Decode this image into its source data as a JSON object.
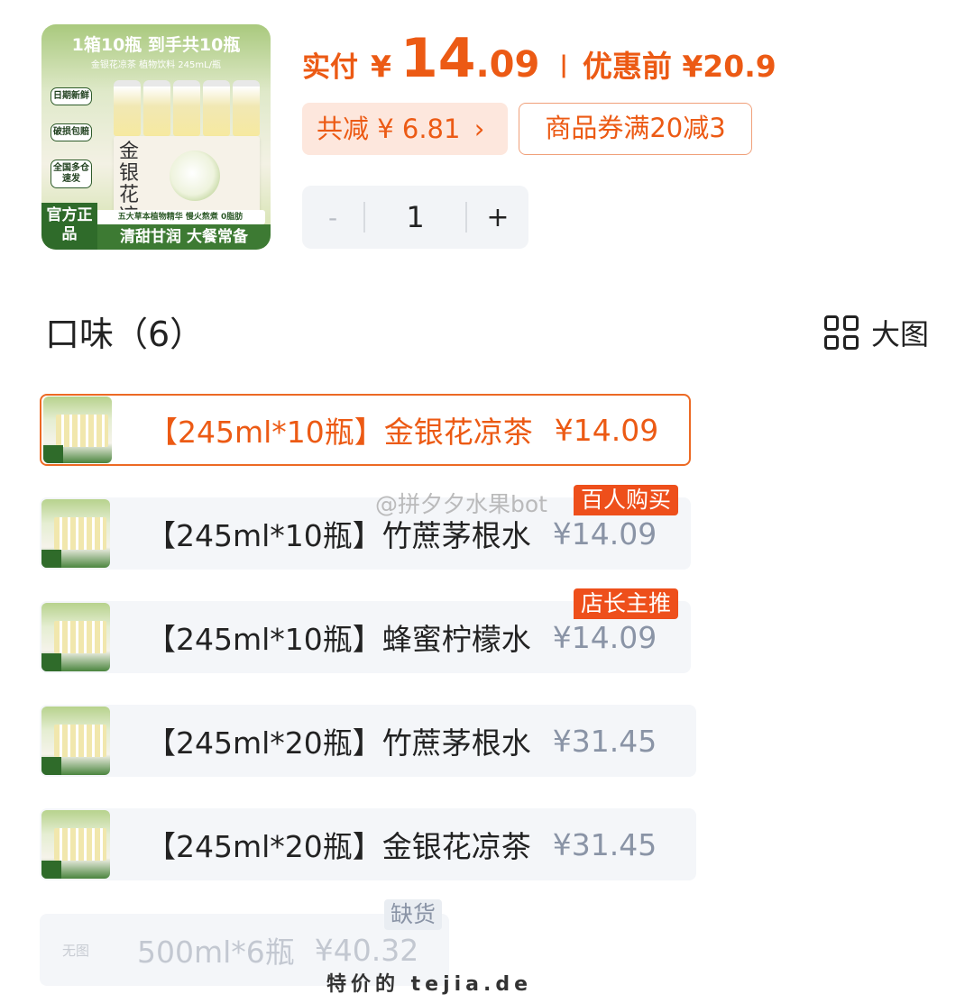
{
  "product": {
    "image": {
      "headline": "1箱10瓶 到手共10瓶",
      "subline": "金银花凉茶 植物饮料 245mL/瓶",
      "badges": [
        "日期新鲜",
        "破损包赔",
        "全国多仓速发"
      ],
      "box_text": "金银花凉茶",
      "strip": "五大草本植物精华 慢火熬煮 0脂肪",
      "official": "官方正品",
      "slogan": "清甜甘润 大餐常备"
    },
    "price_label": "实付",
    "currency": "¥",
    "price_int": "14",
    "price_dec": ".09",
    "separator": "|",
    "orig_label": "优惠前 ¥20.9",
    "discount_text": "共减 ¥ 6.81",
    "discount_chevron": "›",
    "coupon_text": "商品券满20减3",
    "stepper": {
      "minus": "-",
      "qty": "1",
      "plus": "+"
    }
  },
  "section": {
    "title": "口味（6）",
    "big_view_label": "大图"
  },
  "options": [
    {
      "label": "【245ml*10瓶】金银花凉茶",
      "price": "¥14.09",
      "selected": true
    },
    {
      "label": "【245ml*10瓶】竹蔗茅根水",
      "price": "¥14.09",
      "tag": "百人购买"
    },
    {
      "label": "【245ml*10瓶】蜂蜜柠檬水",
      "price": "¥14.09",
      "tag": "店长主推"
    },
    {
      "label": "【245ml*20瓶】竹蔗茅根水",
      "price": "¥31.45"
    },
    {
      "label": "【245ml*20瓶】金银花凉茶",
      "price": "¥31.45"
    },
    {
      "label": "500ml*6瓶",
      "price": "¥40.32",
      "no_image": "无图",
      "soldout": "缺货",
      "disabled": true
    }
  ],
  "watermarks": {
    "weibo": "@拼夕夕水果bot",
    "site": "特价的 tejia.de"
  },
  "colors": {
    "accent": "#ec5a14",
    "tag_red": "#ee4f1b",
    "muted_price": "#8a94a6",
    "row_bg": "#f4f6f9"
  }
}
